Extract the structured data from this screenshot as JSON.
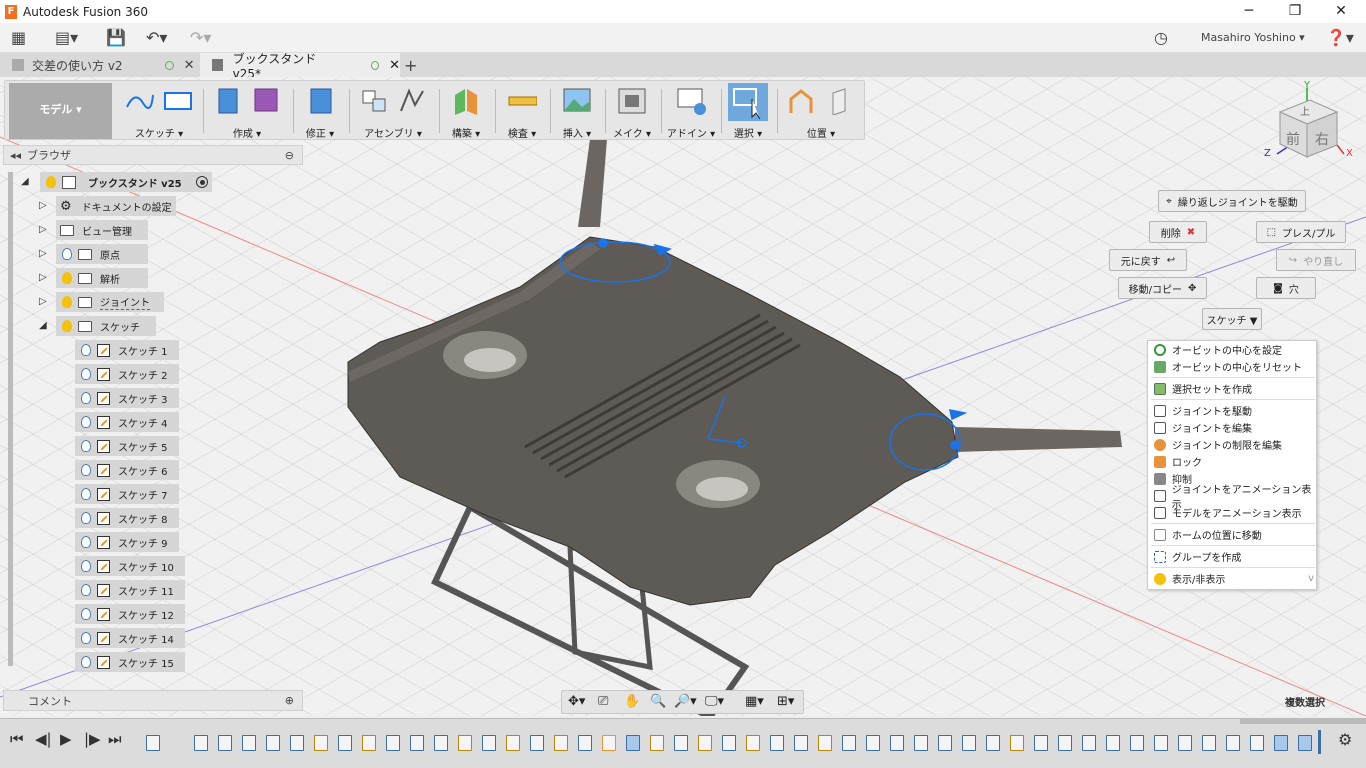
{
  "app": {
    "title": "Autodesk Fusion 360",
    "user": "Masahiro Yoshino"
  },
  "tabs": [
    {
      "label": "交差の使い方 v2"
    },
    {
      "label": "ブックスタンド v25*"
    }
  ],
  "toolbar": {
    "mode": "モデル ▾",
    "groups": [
      {
        "label": "スケッチ ▾"
      },
      {
        "label": "作成 ▾"
      },
      {
        "label": "修正 ▾"
      },
      {
        "label": "アセンブリ ▾"
      },
      {
        "label": "構築 ▾"
      },
      {
        "label": "検査 ▾"
      },
      {
        "label": "挿入 ▾"
      },
      {
        "label": "メイク ▾"
      },
      {
        "label": "アドイン ▾"
      },
      {
        "label": "選択 ▾"
      },
      {
        "label": "位置 ▾"
      }
    ]
  },
  "browser": {
    "title": "ブラウザ",
    "root": "ブックスタンド v25",
    "nodes": [
      {
        "label": "ドキュメントの設定"
      },
      {
        "label": "ビュー管理"
      },
      {
        "label": "原点"
      },
      {
        "label": "解析"
      },
      {
        "label": "ジョイント"
      },
      {
        "label": "スケッチ"
      }
    ],
    "sketches": [
      "スケッチ 1",
      "スケッチ 2",
      "スケッチ 3",
      "スケッチ 4",
      "スケッチ 5",
      "スケッチ 6",
      "スケッチ 7",
      "スケッチ 8",
      "スケッチ 9",
      "スケッチ 10",
      "スケッチ 11",
      "スケッチ 12",
      "スケッチ 14",
      "スケッチ 15"
    ]
  },
  "comments": {
    "title": "コメント"
  },
  "viewcube": {
    "top": "上",
    "front": "前",
    "right": "右",
    "z": "Z",
    "x": "X",
    "y": "Y"
  },
  "marking": {
    "repeat": "繰り返しジョイントを駆動",
    "delete": "削除",
    "presspull": "プレス/プル",
    "undo": "元に戻す",
    "redo": "やり直し",
    "movecopy": "移動/コピー",
    "hole": "穴",
    "sketch": "スケッチ ▼"
  },
  "menu": {
    "items": [
      {
        "label": "オービットの中心を設定",
        "icon": "orbit-center-icon"
      },
      {
        "label": "オービットの中心をリセット",
        "icon": "orbit-reset-icon"
      },
      {
        "label": "選択セットを作成",
        "icon": "selection-set-icon"
      },
      {
        "label": "ジョイントを駆動",
        "icon": "drive-joint-icon"
      },
      {
        "label": "ジョイントを編集",
        "icon": "edit-joint-icon"
      },
      {
        "label": "ジョイントの制限を編集",
        "icon": "joint-limits-icon"
      },
      {
        "label": "ロック",
        "icon": "lock-icon"
      },
      {
        "label": "抑制",
        "icon": "suppress-icon"
      },
      {
        "label": "ジョイントをアニメーション表示",
        "icon": "animate-joint-icon"
      },
      {
        "label": "モデルをアニメーション表示",
        "icon": "animate-model-icon"
      },
      {
        "label": "ホームの位置に移動",
        "icon": "home-icon"
      },
      {
        "label": "グループを作成",
        "icon": "group-icon"
      },
      {
        "label": "表示/非表示",
        "icon": "bulb-icon"
      }
    ],
    "more": "v"
  },
  "status": {
    "multi_select": "複数選択"
  },
  "colors": {
    "accent": "#0696d7",
    "body": "#5e5a55",
    "highlight": "#1a73e8",
    "bulb": "#f4c20d"
  }
}
